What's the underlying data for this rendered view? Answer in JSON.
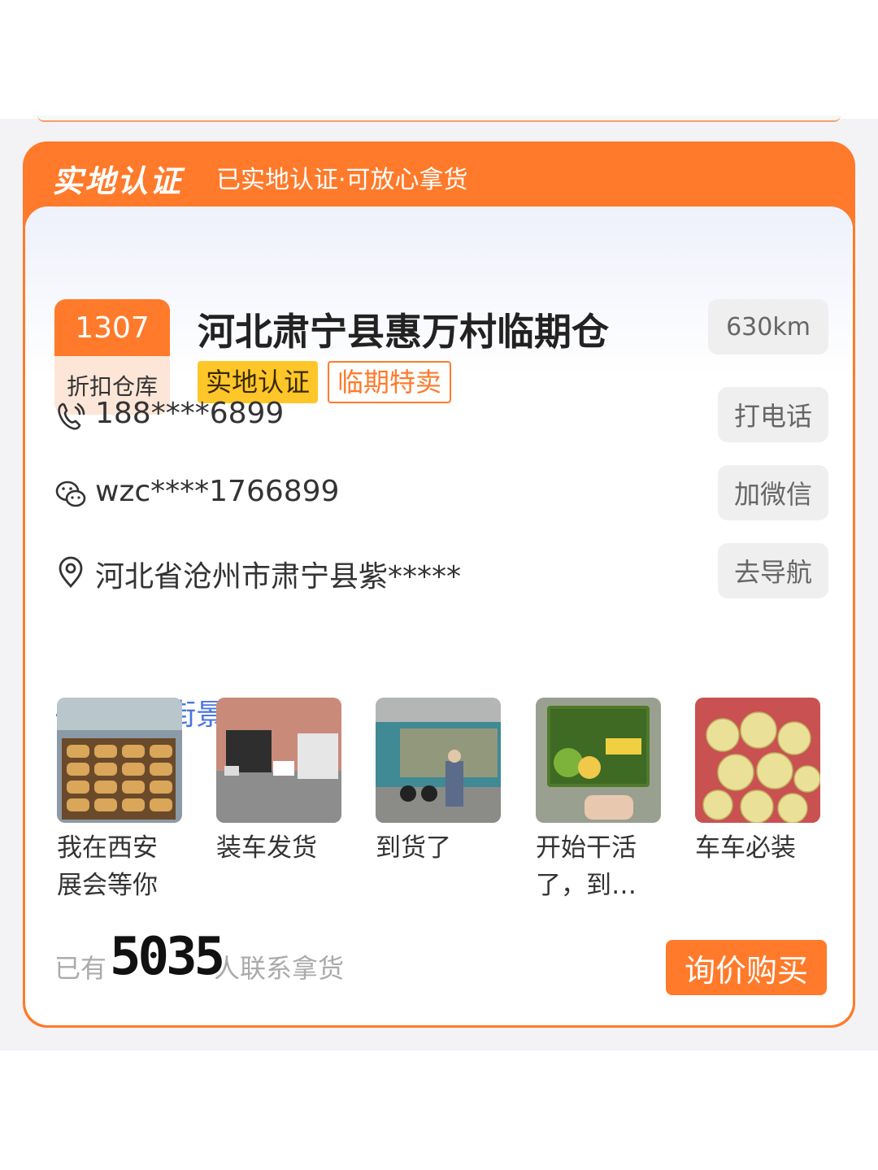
{
  "header": {
    "badge": "实地认证",
    "text": "已实地认证·可放心拿货"
  },
  "store": {
    "number": "1307",
    "type": "折扣仓库",
    "title": "河北肃宁县惠万村临期仓",
    "tags": [
      "实地认证",
      "临期特卖"
    ],
    "distance": "630km"
  },
  "contacts": {
    "phone": {
      "value": "188****6899",
      "button": "打电话",
      "icon": "phone-icon"
    },
    "wechat": {
      "value": "wzc****1766899",
      "button": "加微信",
      "icon": "wechat-icon"
    },
    "address": {
      "value": "河北省沧州市肃宁县紫*****",
      "button": "去导航",
      "icon": "location-pin-icon"
    }
  },
  "map_link": "→看商家街景位置地图",
  "thumbnails": [
    {
      "caption": "我在西安展会等你"
    },
    {
      "caption": "装车发货"
    },
    {
      "caption": "到货了"
    },
    {
      "caption": "开始干活了，到…"
    },
    {
      "caption": "车车必装"
    }
  ],
  "footer": {
    "prefix": "已有",
    "count": "5035",
    "suffix": "人联系拿货",
    "cta": "询价购买"
  },
  "colors": {
    "accent": "#ff7a2a",
    "tag_yellow": "#ffc629",
    "link": "#4a74e0"
  }
}
